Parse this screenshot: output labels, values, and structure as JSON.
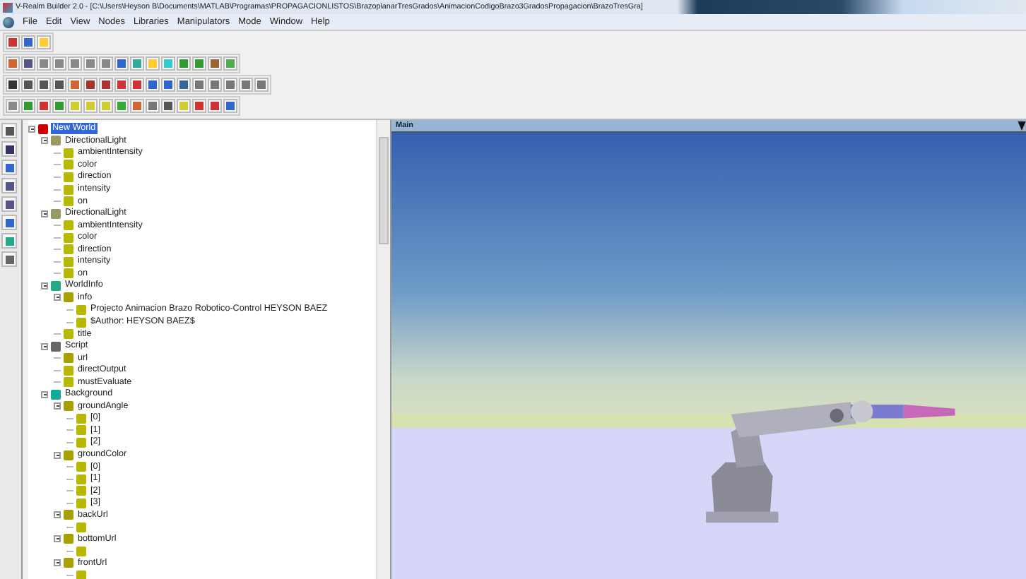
{
  "window": {
    "title": "V-Realm Builder 2.0 - [C:\\Users\\Heyson B\\Documents\\MATLAB\\Programas\\PROPAGACIONLISTOS\\BrazoplanarTresGrados\\AnimacionCodigoBrazo3GradosPropagacion\\BrazoTresGra]"
  },
  "menu": [
    "File",
    "Edit",
    "View",
    "Nodes",
    "Libraries",
    "Manipulators",
    "Mode",
    "Window",
    "Help"
  ],
  "tree": [
    {
      "label": "New World",
      "kind": "world",
      "selected": true,
      "expanded": true,
      "children": [
        {
          "label": "DirectionalLight",
          "kind": "light",
          "selected": false,
          "expanded": true,
          "children": [
            {
              "label": "ambientIntensity",
              "kind": "field",
              "selected": false
            },
            {
              "label": "color",
              "kind": "field",
              "selected": false
            },
            {
              "label": "direction",
              "kind": "field",
              "selected": false
            },
            {
              "label": "intensity",
              "kind": "field",
              "selected": false
            },
            {
              "label": "on",
              "kind": "field",
              "selected": false
            }
          ]
        },
        {
          "label": "DirectionalLight",
          "kind": "light",
          "selected": false,
          "expanded": true,
          "children": [
            {
              "label": "ambientIntensity",
              "kind": "field",
              "selected": false
            },
            {
              "label": "color",
              "kind": "field",
              "selected": false
            },
            {
              "label": "direction",
              "kind": "field",
              "selected": false
            },
            {
              "label": "intensity",
              "kind": "field",
              "selected": false
            },
            {
              "label": "on",
              "kind": "field",
              "selected": false
            }
          ]
        },
        {
          "label": "WorldInfo",
          "kind": "worldinfo",
          "selected": false,
          "expanded": true,
          "children": [
            {
              "label": "info",
              "kind": "mfield",
              "selected": false,
              "expanded": true,
              "children": [
                {
                  "label": "Projecto Animacion Brazo Robotico-Control  HEYSON BAEZ",
                  "kind": "field",
                  "selected": false
                },
                {
                  "label": "$Author: HEYSON BAEZ$",
                  "kind": "field",
                  "selected": false
                }
              ]
            },
            {
              "label": "title",
              "kind": "field",
              "selected": false
            }
          ]
        },
        {
          "label": "Script",
          "kind": "script",
          "selected": false,
          "expanded": true,
          "children": [
            {
              "label": "url",
              "kind": "mfield",
              "selected": false
            },
            {
              "label": "directOutput",
              "kind": "field",
              "selected": false
            },
            {
              "label": "mustEvaluate",
              "kind": "field",
              "selected": false
            }
          ]
        },
        {
          "label": "Background",
          "kind": "background",
          "selected": false,
          "expanded": true,
          "children": [
            {
              "label": "groundAngle",
              "kind": "mfield",
              "selected": false,
              "expanded": true,
              "children": [
                {
                  "label": "[0]",
                  "kind": "field",
                  "selected": false
                },
                {
                  "label": "[1]",
                  "kind": "field",
                  "selected": false
                },
                {
                  "label": "[2]",
                  "kind": "field",
                  "selected": false
                }
              ]
            },
            {
              "label": "groundColor",
              "kind": "mfield",
              "selected": false,
              "expanded": true,
              "children": [
                {
                  "label": "[0]",
                  "kind": "field",
                  "selected": false
                },
                {
                  "label": "[1]",
                  "kind": "field",
                  "selected": false
                },
                {
                  "label": "[2]",
                  "kind": "field",
                  "selected": false
                },
                {
                  "label": "[3]",
                  "kind": "field",
                  "selected": false
                }
              ]
            },
            {
              "label": "backUrl",
              "kind": "mfield",
              "selected": false,
              "expanded": true,
              "children": [
                {
                  "kind": "field",
                  "selected": false
                }
              ]
            },
            {
              "label": "bottomUrl",
              "kind": "mfield",
              "selected": false,
              "expanded": true,
              "children": [
                {
                  "kind": "field",
                  "selected": false
                }
              ]
            },
            {
              "label": "frontUrl",
              "kind": "mfield",
              "selected": false,
              "expanded": true,
              "children": [
                {
                  "kind": "field",
                  "selected": false
                }
              ]
            }
          ]
        }
      ]
    }
  ],
  "view": {
    "title": "Main"
  }
}
